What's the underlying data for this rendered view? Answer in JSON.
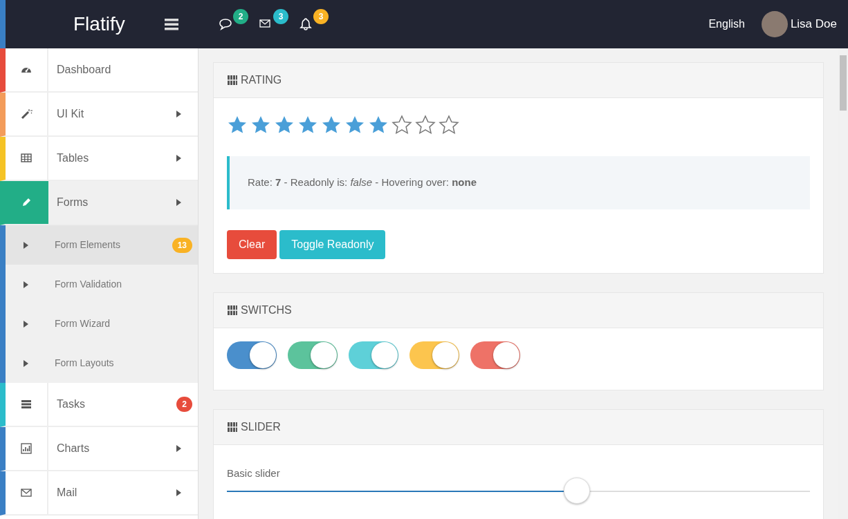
{
  "navbar": {
    "brand": "Flatify",
    "notifications": [
      {
        "kind": "chat",
        "count": "2",
        "color": "#22ae87"
      },
      {
        "kind": "mail",
        "count": "3",
        "color": "#2bbccb"
      },
      {
        "kind": "bell",
        "count": "3",
        "color": "#f9b224"
      }
    ],
    "language": "English",
    "user": "Lisa Doe"
  },
  "sidebar": {
    "items": [
      {
        "kind": "dashboard",
        "label": "Dashboard",
        "color": "#e74c3c",
        "arrow": false,
        "selected": false
      },
      {
        "kind": "wand",
        "label": "UI Kit",
        "color": "#f39c5a",
        "arrow": true,
        "selected": false
      },
      {
        "kind": "table",
        "label": "Tables",
        "color": "#f5c325",
        "arrow": true,
        "selected": false
      },
      {
        "kind": "pencil",
        "label": "Forms",
        "color": "#22ae87",
        "arrow": true,
        "selected": true,
        "expanded": true,
        "children": [
          {
            "label": "Form Elements",
            "selected": true,
            "badge": {
              "text": "13",
              "color": "#f9b224"
            }
          },
          {
            "label": "Form Validation",
            "selected": false
          },
          {
            "label": "Form Wizard",
            "selected": false
          },
          {
            "label": "Form Layouts",
            "selected": false
          }
        ]
      },
      {
        "kind": "tasks",
        "label": "Tasks",
        "color": "#2bbccb",
        "arrow": false,
        "selected": false,
        "badge": {
          "text": "2",
          "color": "#e74c3c"
        }
      },
      {
        "kind": "chart",
        "label": "Charts",
        "color": "#3a7fc4",
        "arrow": true,
        "selected": false
      },
      {
        "kind": "mail",
        "label": "Mail",
        "color": "#3a7fc4",
        "arrow": true,
        "selected": false
      }
    ]
  },
  "rating": {
    "title": "RATING",
    "stars": 7,
    "status": "Rate: **7** - Readonly is: *false* - Hovering over: **none**",
    "buttons": [
      {
        "label": "Clear",
        "kind": "danger"
      },
      {
        "label": "Toggle Readonly",
        "kind": "info"
      }
    ]
  },
  "switchs": {
    "title": "SWITCHS",
    "items": [
      {
        "on": true,
        "color": "#4a8fcc"
      },
      {
        "on": true,
        "color": "#5cc39c"
      },
      {
        "on": true,
        "color": "#5ed0d8"
      },
      {
        "on": true,
        "color": "#fcc54e"
      },
      {
        "on": true,
        "color": "#ee7267"
      }
    ]
  },
  "slider": {
    "title": "SLIDER",
    "label": "Basic slider",
    "level": 0.6
  }
}
